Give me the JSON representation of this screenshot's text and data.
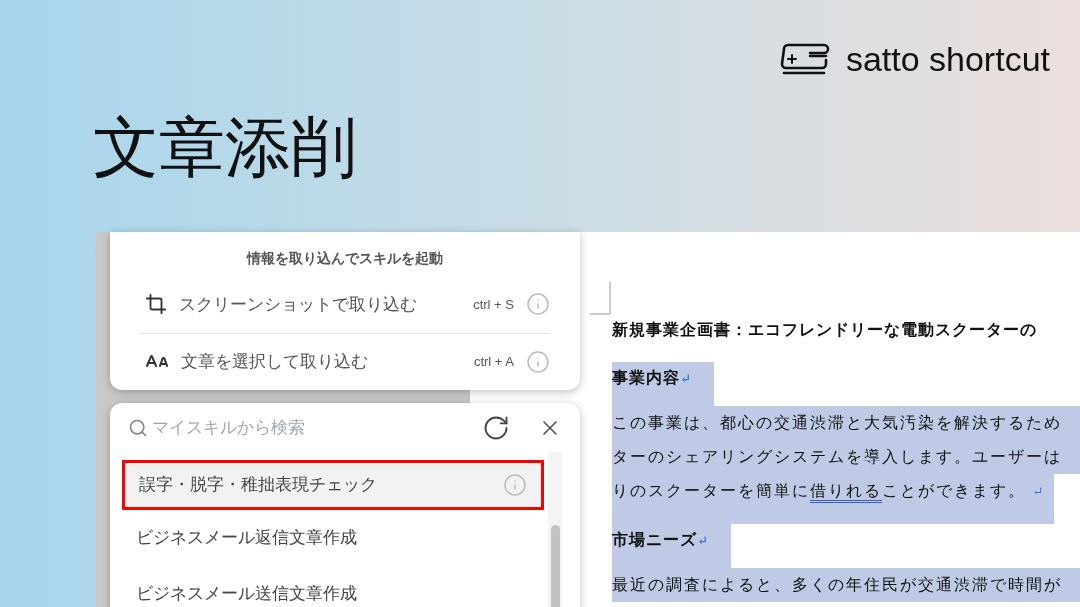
{
  "brand": {
    "name": "satto shortcut"
  },
  "heading": "文章添削",
  "capture_panel": {
    "title": "情報を取り込んでスキルを起動",
    "options": [
      {
        "kind": "crop",
        "label": "スクリーンショットで取り込む",
        "shortcut": "ctrl + S"
      },
      {
        "kind": "text",
        "label": "文章を選択して取り込む",
        "shortcut": "ctrl + A"
      }
    ]
  },
  "skills_panel": {
    "search": {
      "placeholder": "マイスキルから検索"
    },
    "items": [
      {
        "label": "誤字・脱字・稚拙表現チェック",
        "selected": true,
        "highlighted": true
      },
      {
        "label": "ビジネスメール返信文章作成",
        "selected": false,
        "highlighted": false
      },
      {
        "label": "ビジネスメール送信文章作成",
        "selected": false,
        "highlighted": false
      }
    ]
  },
  "document": {
    "title": "新規事業企画書：エコフレンドリーな電動スクーターの",
    "blocks": [
      {
        "kind": "heading",
        "selected": true,
        "mark": "↵",
        "text": "事業内容"
      },
      {
        "kind": "paragraph",
        "selected": true,
        "mark": "↵",
        "lines": [
          [
            {
              "text": "この事業は、都心の交通渋滞と大気汚染を解決するため",
              "flagged": false
            }
          ],
          [
            {
              "text": "ターのシェアリングシステムを導入します。ユーザーは",
              "flagged": false
            }
          ],
          [
            {
              "text": "りのスクーターを簡単に",
              "flagged": false
            },
            {
              "text": "借りれる",
              "flagged": true
            },
            {
              "text": "ことができます。",
              "flagged": false
            }
          ]
        ]
      },
      {
        "kind": "heading",
        "selected": true,
        "mark": "↵",
        "text": "市場ニーズ"
      },
      {
        "kind": "paragraph",
        "selected": true,
        "lines": [
          [
            {
              "text": "最近の調査によると、多くの年住民が交通渋滞で時間が",
              "flagged": false
            }
          ]
        ]
      }
    ]
  }
}
